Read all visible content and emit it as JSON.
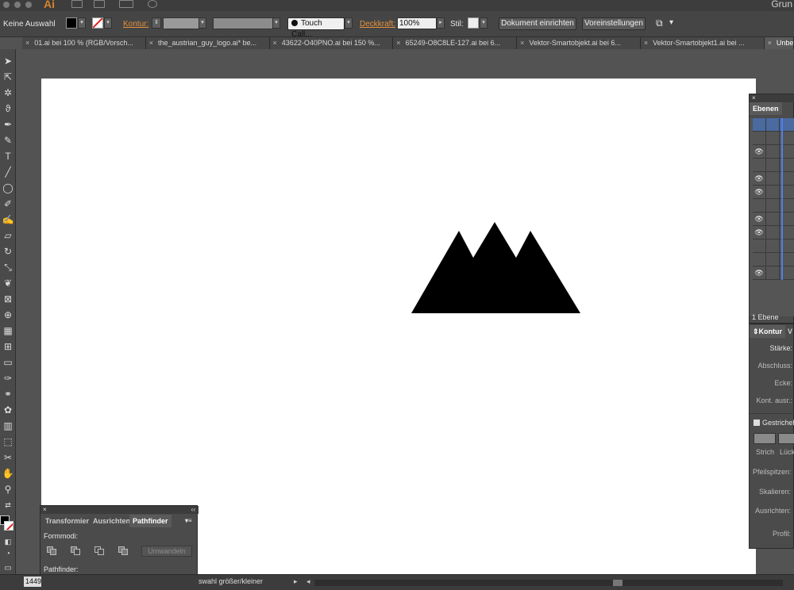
{
  "titlebar": {
    "app_logo": "Ai",
    "app_name": "Grun"
  },
  "controlbar": {
    "selection": "Keine Auswahl",
    "kontur_label": "Kontur:",
    "brush": "Touch Call...",
    "opacity_label": "Deckkraft:",
    "opacity_value": "100%",
    "style_label": "Stil:",
    "doc_setup": "Dokument einrichten",
    "preferences": "Voreinstellungen"
  },
  "tabs": [
    "01.ai bei 100 % (RGB/Vorsch...",
    "the_austrian_guy_logo.ai* be...",
    "43622-O40PNO.ai bei 150 %...",
    "65249-O8C8LE-127.ai bei 6...",
    "Vektor-Smartobjekt.ai bei 6...",
    "Vektor-Smartobjekt1.ai bei ...",
    "Unbe"
  ],
  "layers_panel": {
    "tab": "Ebenen",
    "count": "1 Ebene",
    "rows": [
      {
        "visible": false,
        "selected": true
      },
      {
        "visible": false,
        "selected": false
      },
      {
        "visible": true,
        "selected": false
      },
      {
        "visible": false,
        "selected": false
      },
      {
        "visible": true,
        "selected": false
      },
      {
        "visible": true,
        "selected": false
      },
      {
        "visible": false,
        "selected": false
      },
      {
        "visible": true,
        "selected": false
      },
      {
        "visible": true,
        "selected": false
      },
      {
        "visible": false,
        "selected": false
      },
      {
        "visible": false,
        "selected": false
      },
      {
        "visible": true,
        "selected": false
      }
    ]
  },
  "stroke_panel": {
    "tab": "Kontur",
    "tab2": "V",
    "weight": "Stärke:",
    "cap": "Abschluss:",
    "corner": "Ecke:",
    "align": "Kont. ausr.:",
    "dashed": "Gestrichel",
    "dash": "Strich",
    "gap": "Lück",
    "arrowheads": "Pfeilspitzen:",
    "scale": "Skalieren:",
    "align2": "Ausrichten:",
    "profile": "Profil:"
  },
  "pathfinder_panel": {
    "tabs": [
      "Transformier",
      "Ausrichten",
      "Pathfinder"
    ],
    "shape_modes": "Formmodi:",
    "expand": "Umwandeln",
    "pathfinders": "Pathfinder:"
  },
  "statusbar": {
    "zoom": "1449",
    "hint": "swahl größer/kleiner"
  },
  "colors": {
    "accent_orange": "#e8913a",
    "layer_blue": "#4f7fe8"
  }
}
